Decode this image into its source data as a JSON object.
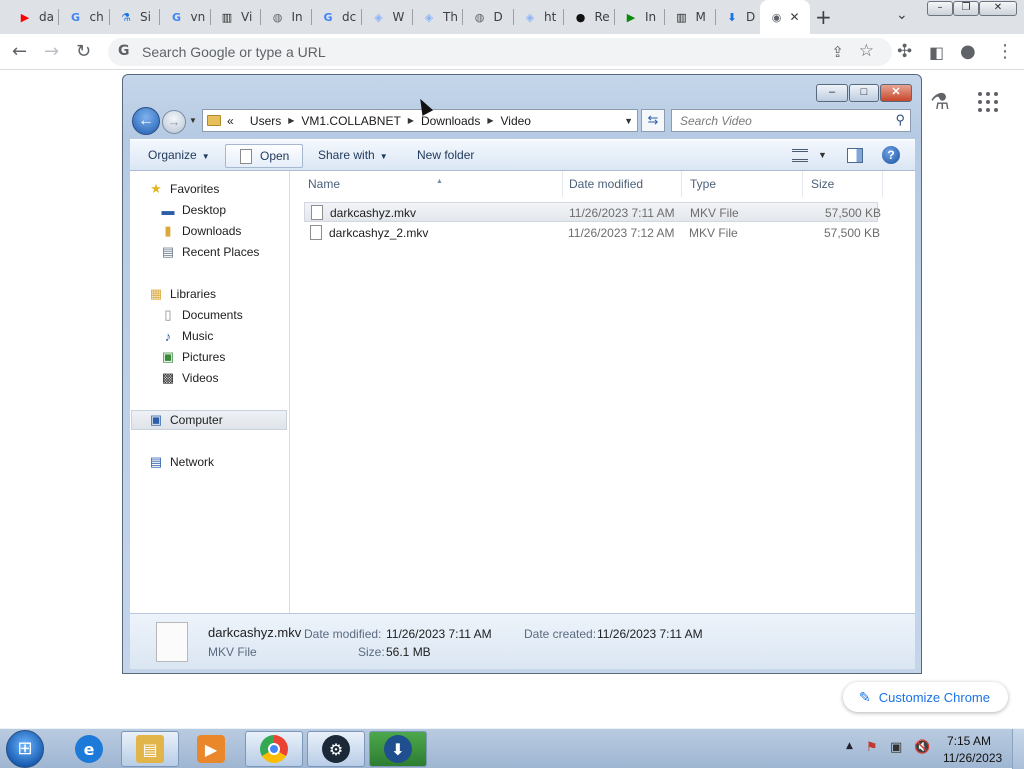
{
  "chrome": {
    "tabs": [
      {
        "title": "da",
        "icon": "youtube-icon",
        "color": "#ff0000",
        "glyph": "▶"
      },
      {
        "title": "ch",
        "icon": "google-icon",
        "color": "#4285f4",
        "glyph": "G"
      },
      {
        "title": "Si",
        "icon": "flask-icon",
        "color": "#1a73e8",
        "glyph": "⚗"
      },
      {
        "title": "vn",
        "icon": "google-icon",
        "color": "#4285f4",
        "glyph": "G"
      },
      {
        "title": "Vi",
        "icon": "museum-icon",
        "color": "#222222",
        "glyph": "▥"
      },
      {
        "title": "In",
        "icon": "globe-icon",
        "color": "#5f6368",
        "glyph": "◍"
      },
      {
        "title": "dc",
        "icon": "google-icon",
        "color": "#4285f4",
        "glyph": "G"
      },
      {
        "title": "W",
        "icon": "web-icon",
        "color": "#8ab4f8",
        "glyph": "◈"
      },
      {
        "title": "Th",
        "icon": "web-icon",
        "color": "#8ab4f8",
        "glyph": "◈"
      },
      {
        "title": "D",
        "icon": "globe-icon",
        "color": "#5f6368",
        "glyph": "◍"
      },
      {
        "title": "ht",
        "icon": "web-icon",
        "color": "#8ab4f8",
        "glyph": "◈"
      },
      {
        "title": "Re",
        "icon": "github-icon",
        "color": "#111111",
        "glyph": "●"
      },
      {
        "title": "In",
        "icon": "play-icon",
        "color": "#0a8a0a",
        "glyph": "▶"
      },
      {
        "title": "M",
        "icon": "museum-icon",
        "color": "#222222",
        "glyph": "▥"
      },
      {
        "title": "D",
        "icon": "download-icon",
        "color": "#1a73e8",
        "glyph": "⬇"
      },
      {
        "title": "",
        "icon": "chrome-icon",
        "color": "#5f6368",
        "glyph": "◉"
      }
    ],
    "new_tab": "+",
    "tab_search": "⌄",
    "window_buttons": {
      "minimize": "–",
      "restore": "❐",
      "close": "✕"
    },
    "omnibox_placeholder": "Search Google or type a URL",
    "customize_label": "Customize Chrome"
  },
  "explorer": {
    "breadcrumb": [
      "«",
      "Users",
      "VM1.COLLABNET",
      "Downloads",
      "Video"
    ],
    "search_placeholder": "Search Video",
    "commands": {
      "organize": "Organize",
      "open": "Open",
      "share_with": "Share with",
      "new_folder": "New folder"
    },
    "nav": {
      "favorites": "Favorites",
      "desktop": "Desktop",
      "downloads": "Downloads",
      "recent_places": "Recent Places",
      "libraries": "Libraries",
      "documents": "Documents",
      "music": "Music",
      "pictures": "Pictures",
      "videos": "Videos",
      "computer": "Computer",
      "network": "Network"
    },
    "columns": {
      "name": "Name",
      "date_modified": "Date modified",
      "type": "Type",
      "size": "Size"
    },
    "files": [
      {
        "name": "darkcashyz.mkv",
        "date": "11/26/2023 7:11 AM",
        "type": "MKV File",
        "size": "57,500 KB"
      },
      {
        "name": "darkcashyz_2.mkv",
        "date": "11/26/2023 7:12 AM",
        "type": "MKV File",
        "size": "57,500 KB"
      }
    ],
    "details": {
      "name": "darkcashyz.mkv",
      "type": "MKV File",
      "date_modified_label": "Date modified:",
      "date_modified": "11/26/2023 7:11 AM",
      "date_created_label": "Date created:",
      "date_created": "11/26/2023 7:11 AM",
      "size_label": "Size:",
      "size": "56.1 MB"
    }
  },
  "taskbar": {
    "time": "7:15 AM",
    "date": "11/26/2023"
  }
}
